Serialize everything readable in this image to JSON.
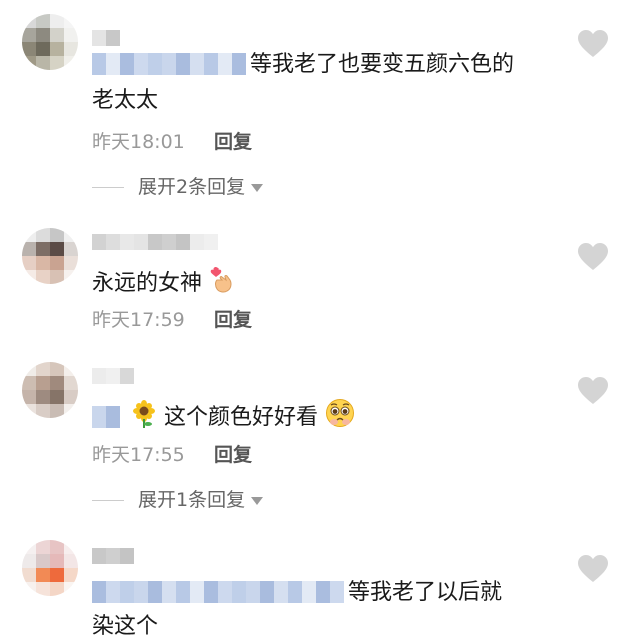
{
  "comments": [
    {
      "text": "等我老了也要变五颜六色的",
      "text_line2": "老太太",
      "time": "昨天18:01",
      "reply_label": "回复",
      "expand_label": "展开2条回复",
      "avatar_colors": [
        "#d8d8d8",
        "#c7c9c4",
        "#eeeeee",
        "#f5f5f5",
        "#a7a59c",
        "#8d8a80",
        "#d3d2ca",
        "#f1f1ef",
        "#8b8676",
        "#6e6a5c",
        "#b7b29f",
        "#e7e6e0",
        "#9f9986",
        "#b9b6a7",
        "#d6d3c5",
        "#f0efea"
      ]
    },
    {
      "text": "永远的女神",
      "time": "昨天17:59",
      "reply_label": "回复",
      "emoji": "finger-heart-emoji",
      "avatar_colors": [
        "#eeeeee",
        "#dcdcdc",
        "#c6c6c6",
        "#f0f0f0",
        "#b9b2ad",
        "#7d6e66",
        "#5b4b46",
        "#d9d4d1",
        "#e6cfc4",
        "#d9b7a5",
        "#c9a391",
        "#eadfd9",
        "#f5ebe6",
        "#e8d2c6",
        "#d8c1b4",
        "#f6f1ee"
      ]
    },
    {
      "text": "这个颜色好好看",
      "time": "昨天17:55",
      "reply_label": "回复",
      "expand_label": "展开1条回复",
      "emoji_prefix": "sunflower-emoji",
      "emoji_suffix": "pleading-face-emoji",
      "avatar_colors": [
        "#f0ece8",
        "#e2d5cc",
        "#d6c6bb",
        "#f4efeb",
        "#cdbdb2",
        "#b89f90",
        "#a08a7d",
        "#e2d8d1",
        "#c5b4aa",
        "#9e8b80",
        "#867468",
        "#d8ccc5",
        "#eae2dd",
        "#d9cdc6",
        "#c9bcb4",
        "#f3efec"
      ]
    },
    {
      "text": "等我老了以后就",
      "text_line2": "染这个",
      "avatar_colors": [
        "#f5f0f0",
        "#ecd5d5",
        "#e7c4c4",
        "#f7eeee",
        "#eeeaea",
        "#d9c9c9",
        "#e5b9b9",
        "#f3e6e6",
        "#f1dcd0",
        "#f28a55",
        "#ee6a3c",
        "#f5d8c8",
        "#f7f1ee",
        "#f6e3da",
        "#f4d6c6",
        "#faf5f2"
      ]
    }
  ],
  "colors": {
    "meta_text": "#999999",
    "reply_text": "#555555",
    "heart": "#d4d4d4",
    "blur_blue": "#b8c9e6"
  }
}
